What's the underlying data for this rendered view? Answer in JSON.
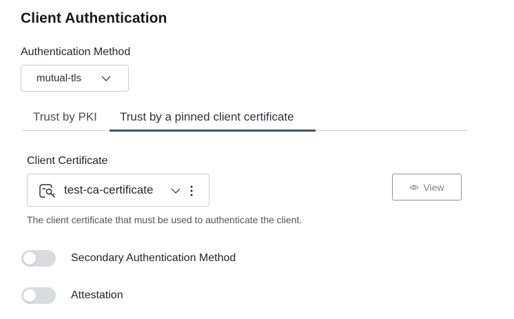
{
  "section": {
    "title": "Client Authentication"
  },
  "auth_method": {
    "label": "Authentication Method",
    "value": "mutual-tls"
  },
  "tabs": [
    {
      "label": "Trust by PKI",
      "active": false
    },
    {
      "label": "Trust by a pinned client certificate",
      "active": true
    }
  ],
  "client_certificate": {
    "label": "Client Certificate",
    "value": "test-ca-certificate",
    "help": "The client certificate that must be used to authenticate the client."
  },
  "view_button": {
    "label": "View"
  },
  "toggles": [
    {
      "label": "Secondary Authentication Method",
      "on": false
    },
    {
      "label": "Attestation",
      "on": false
    }
  ],
  "colors": {
    "tab_active": "#44506a",
    "toggle_off": "#d9dbdf",
    "border": "#c9ccd1"
  },
  "icons": [
    "chevron-down-icon",
    "certificate-icon",
    "kebab-menu-icon",
    "eye-icon"
  ]
}
